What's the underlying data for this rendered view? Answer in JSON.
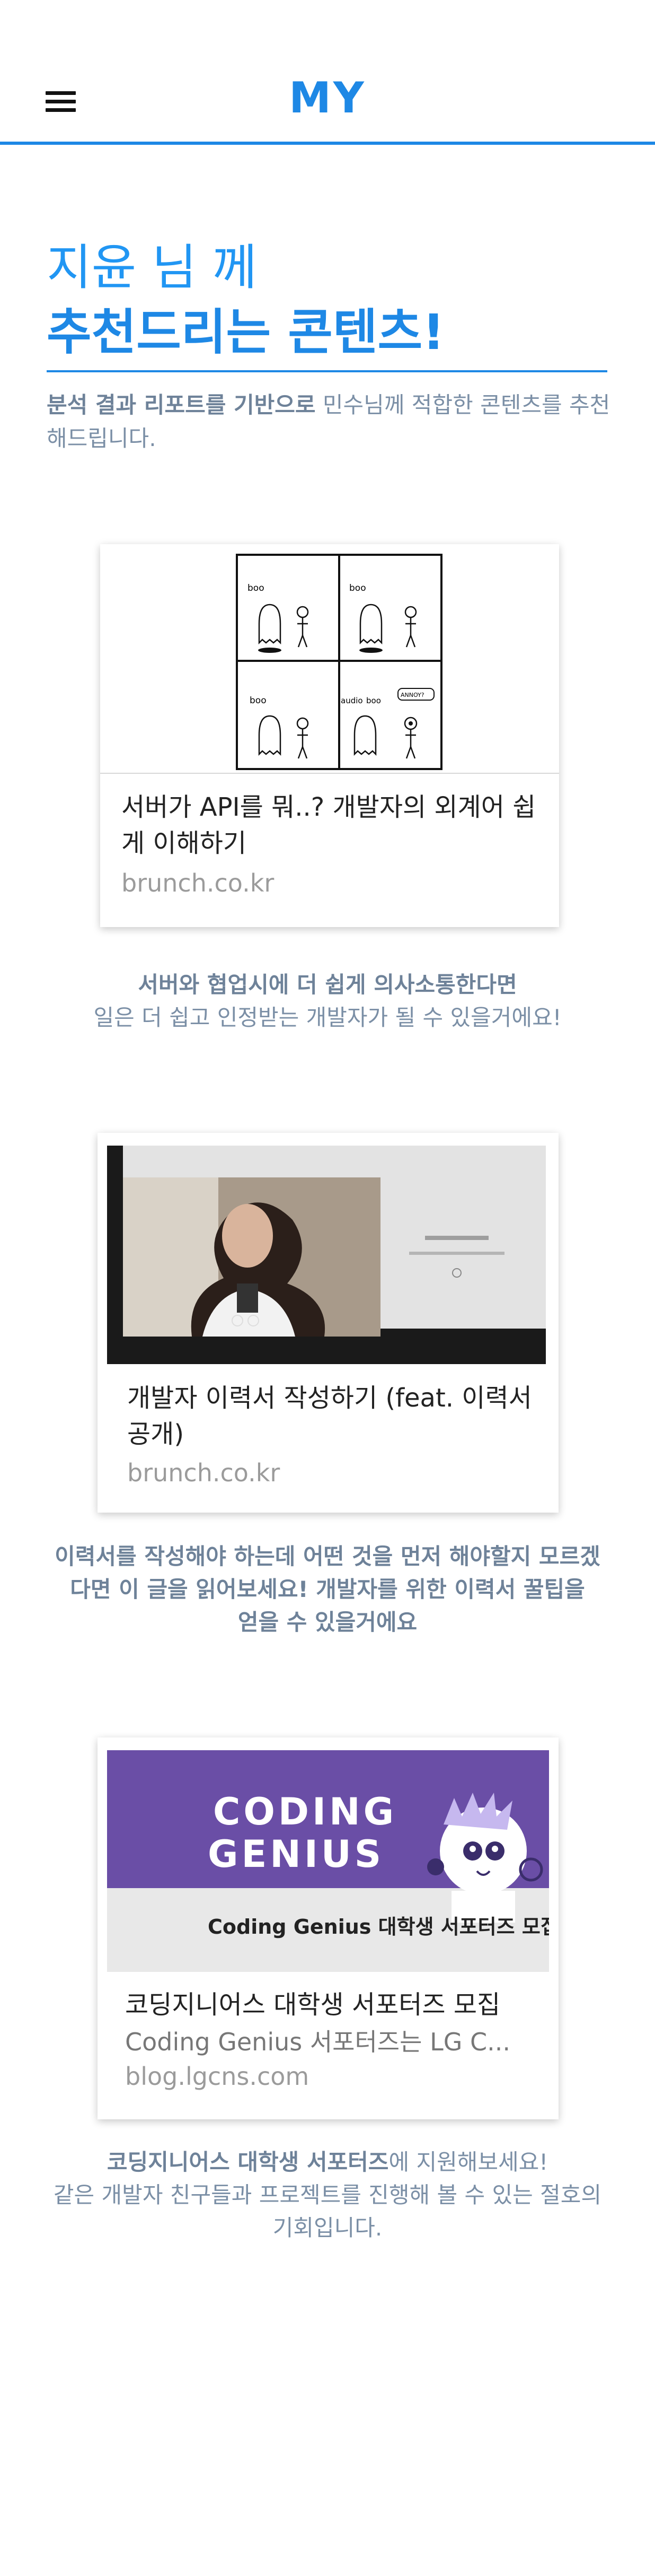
{
  "header": {
    "logo": "MY",
    "menu_icon": "hamburger-menu-icon"
  },
  "greeting": {
    "line1": "지윤 님 께",
    "line2": "추천드리는 콘텐츠!",
    "intro_bold": "분석 결과 리포트를 기반으로",
    "intro_rest": " 민수님께 적합한 콘텐츠를 추천해드립니다."
  },
  "cards": [
    {
      "title": "서버가 API를 뭐..? 개발자의 외계어 쉽게 이해하기",
      "domain": "brunch.co.kr",
      "comic": {
        "b1": "boo",
        "b2": "boo",
        "b3": "boo",
        "b4a": "audio",
        "b4b": "boo",
        "b4c": "ANNOY?"
      },
      "caption_bold": "서버와 협업시에 더 쉽게 의사소통한다면",
      "caption_rest": "일은 더 쉽고 인정받는 개발자가 될 수 있을거에요!"
    },
    {
      "title": "개발자 이력서 작성하기 (feat. 이력서 공개)",
      "domain": "brunch.co.kr",
      "caption_bold": "이력서를 작성해야 하는데 어떤 것을 먼저 해야할지 모르겠다면 이 글을 읽어보세요! 개발자를 위한 이력서 꿀팁을",
      "caption_rest": "얻을 수 있을거에요"
    },
    {
      "title": "코딩지니어스 대학생 서포터즈 모집",
      "subtitle": "Coding Genius 서포터즈는 LG C...",
      "domain": "blog.lgcns.com",
      "banner_line1": "CODING",
      "banner_line2": "GENIUS",
      "banner_caption": "Coding Genius 대학생 서포터즈 모집!",
      "caption_bold": "코딩지니어스 대학생 서포터즈",
      "caption_rest1": "에 지원해보세요!",
      "caption_rest2": "같은 개발자 친구들과 프로젝트를 진행해 볼 수 있는 절호의 기회입니다."
    }
  ],
  "colors": {
    "accent": "#1e88e5",
    "muted_text": "#7b8fa6",
    "banner_purple": "#6a4ea6"
  }
}
